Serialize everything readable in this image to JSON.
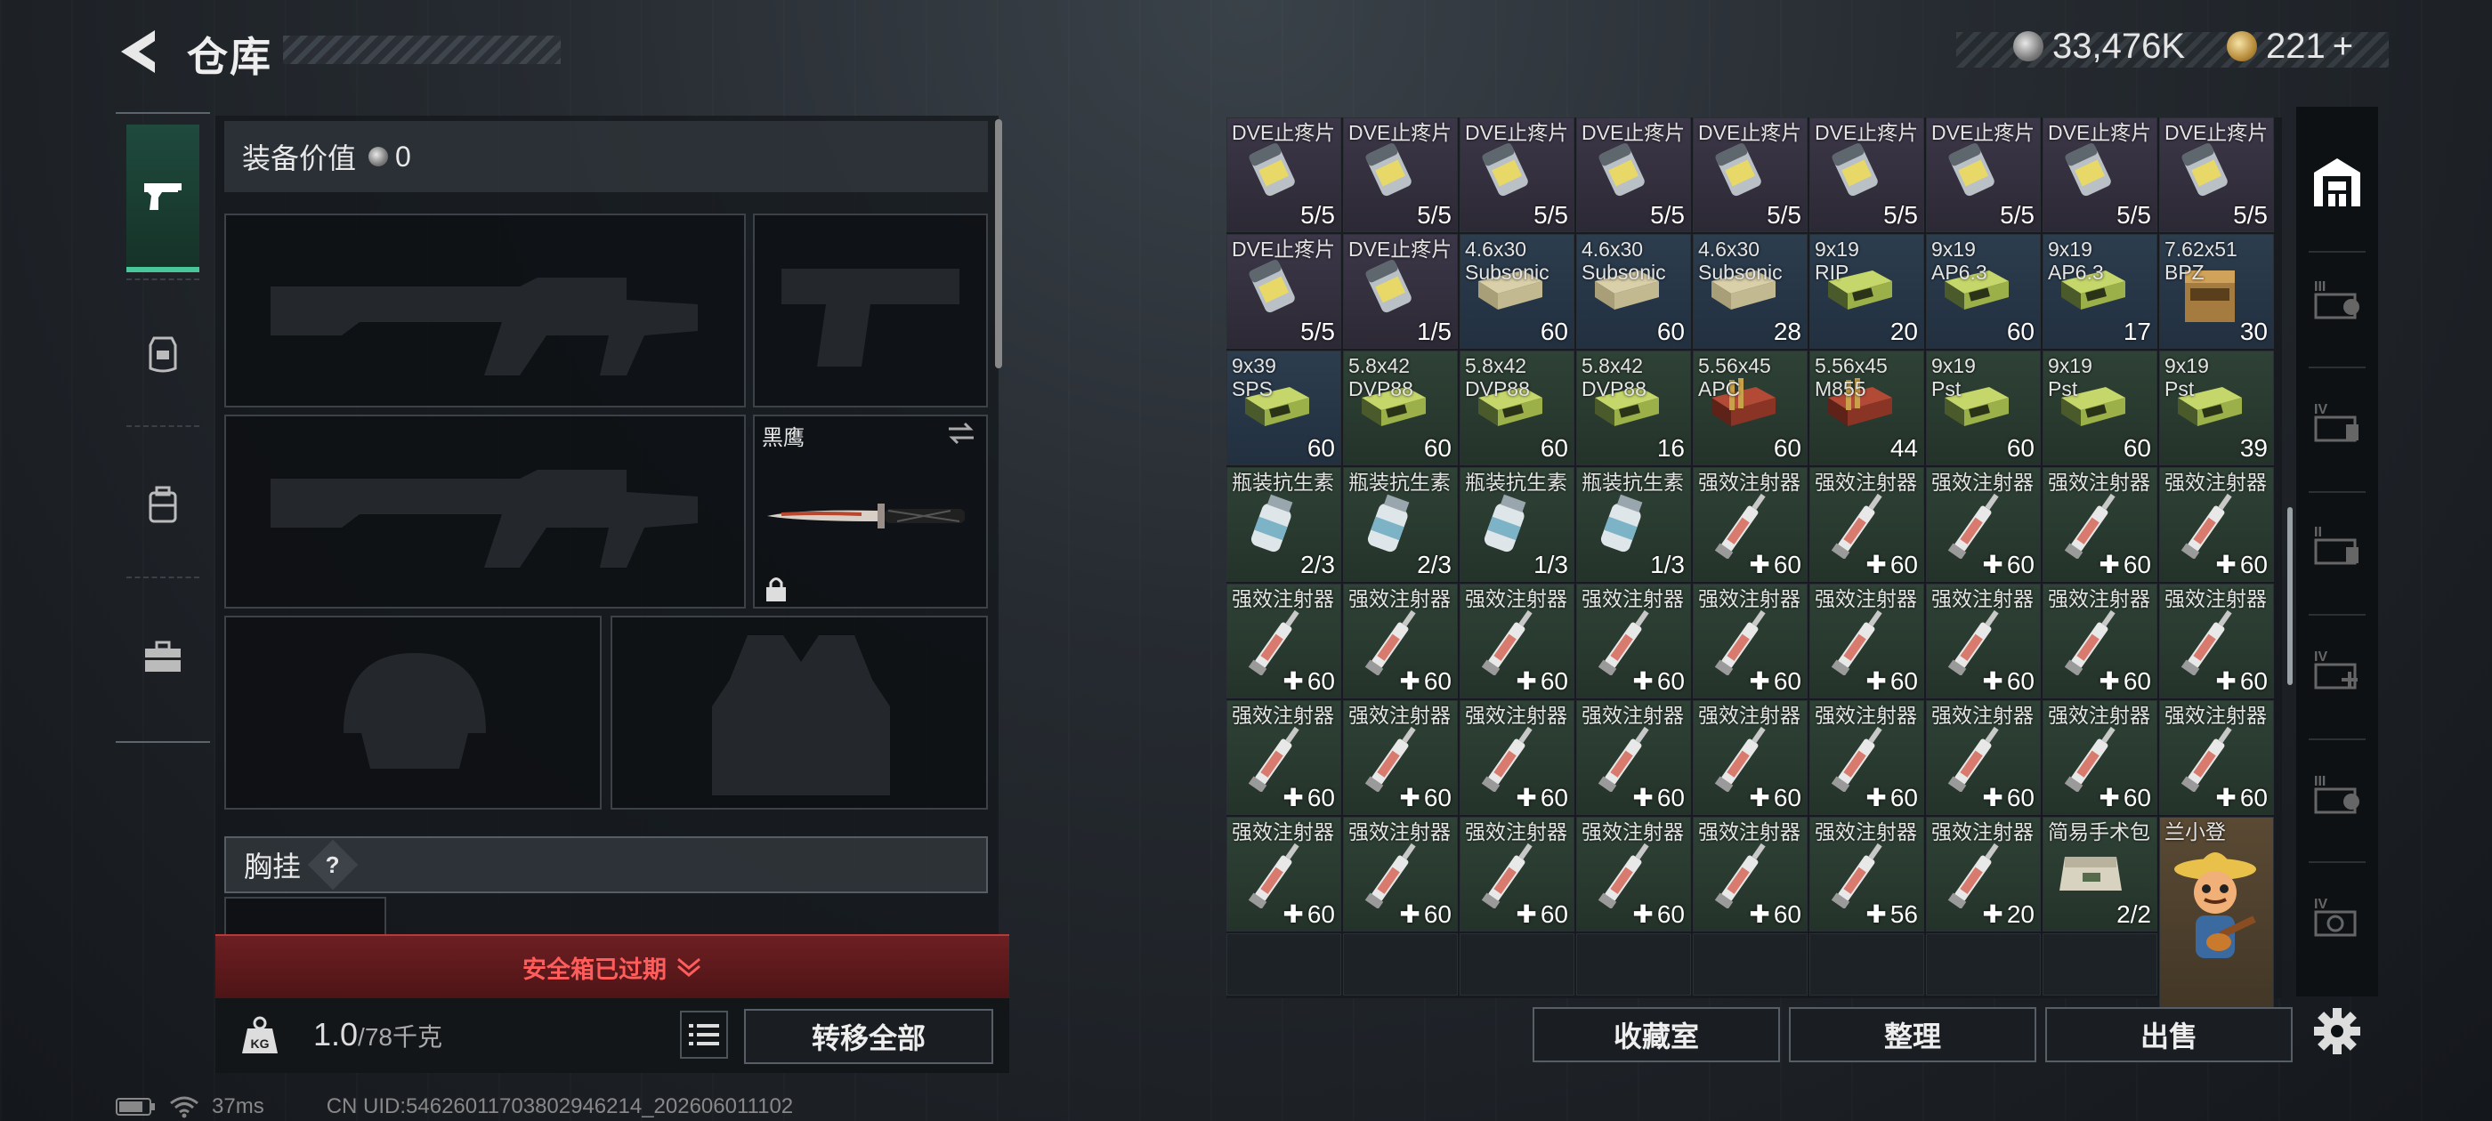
{
  "header": {
    "title": "仓库",
    "silver_amount": "33,476K",
    "gold_amount": "221",
    "gold_add": "+"
  },
  "equipment": {
    "value_label": "装备价值",
    "value": "0",
    "knife_name": "黑鹰",
    "chest_label": "胸挂",
    "chest_help": "?",
    "safebox_text": "安全箱已过期",
    "weight_current": "1.0",
    "weight_max": "/78千克",
    "transfer_all": "转移全部"
  },
  "stash_buttons": {
    "collection": "收藏室",
    "sort": "整理",
    "sell": "出售"
  },
  "status": {
    "ping": "37ms",
    "uid": "CN UID:5462601170380294621‌4_202606011102"
  },
  "stash": {
    "rows": [
      [
        {
          "n": "DVE止疼片",
          "c": "5/5",
          "t": "purple",
          "i": "painkiller"
        },
        {
          "n": "DVE止疼片",
          "c": "5/5",
          "t": "purple",
          "i": "painkiller"
        },
        {
          "n": "DVE止疼片",
          "c": "5/5",
          "t": "purple",
          "i": "painkiller"
        },
        {
          "n": "DVE止疼片",
          "c": "5/5",
          "t": "purple",
          "i": "painkiller"
        },
        {
          "n": "DVE止疼片",
          "c": "5/5",
          "t": "purple",
          "i": "painkiller"
        },
        {
          "n": "DVE止疼片",
          "c": "5/5",
          "t": "purple",
          "i": "painkiller"
        },
        {
          "n": "DVE止疼片",
          "c": "5/5",
          "t": "purple",
          "i": "painkiller"
        },
        {
          "n": "DVE止疼片",
          "c": "5/5",
          "t": "purple",
          "i": "painkiller"
        },
        {
          "n": "DVE止疼片",
          "c": "5/5",
          "t": "purple",
          "i": "painkiller"
        }
      ],
      [
        {
          "n": "DVE止疼片",
          "c": "5/5",
          "t": "purple",
          "i": "painkiller"
        },
        {
          "n": "DVE止疼片",
          "c": "1/5",
          "t": "purple",
          "i": "painkiller"
        },
        {
          "n": "4.6x30",
          "n2": "Subsonic",
          "c": "60",
          "t": "blue",
          "i": "ammo-tan"
        },
        {
          "n": "4.6x30",
          "n2": "Subsonic",
          "c": "60",
          "t": "blue",
          "i": "ammo-tan"
        },
        {
          "n": "4.6x30",
          "n2": "Subsonic",
          "c": "28",
          "t": "blue",
          "i": "ammo-tan"
        },
        {
          "n": "9x19",
          "n2": "RIP",
          "c": "20",
          "t": "blue",
          "i": "ammo-green"
        },
        {
          "n": "9x19",
          "n2": "AP6.3",
          "c": "60",
          "t": "blue",
          "i": "ammo-green"
        },
        {
          "n": "9x19",
          "n2": "AP6.3",
          "c": "17",
          "t": "blue",
          "i": "ammo-green"
        },
        {
          "n": "7.62x51",
          "n2": "BPZ",
          "c": "30",
          "t": "blue",
          "i": "ammo-box"
        }
      ],
      [
        {
          "n": "9x39",
          "n2": "SPS",
          "c": "60",
          "t": "blue",
          "i": "ammo-green"
        },
        {
          "n": "5.8x42",
          "n2": "DVP88",
          "c": "60",
          "t": "green",
          "i": "ammo-green"
        },
        {
          "n": "5.8x42",
          "n2": "DVP88",
          "c": "60",
          "t": "green",
          "i": "ammo-green"
        },
        {
          "n": "5.8x42",
          "n2": "DVP88",
          "c": "16",
          "t": "green",
          "i": "ammo-green"
        },
        {
          "n": "5.56x45",
          "n2": "APC",
          "c": "60",
          "t": "green",
          "i": "ammo-red"
        },
        {
          "n": "5.56x45",
          "n2": "M855",
          "c": "44",
          "t": "green",
          "i": "ammo-red"
        },
        {
          "n": "9x19",
          "n2": "Pst",
          "c": "60",
          "t": "green",
          "i": "ammo-green"
        },
        {
          "n": "9x19",
          "n2": "Pst",
          "c": "60",
          "t": "green",
          "i": "ammo-green"
        },
        {
          "n": "9x19",
          "n2": "Pst",
          "c": "39",
          "t": "green",
          "i": "ammo-green"
        }
      ],
      [
        {
          "n": "瓶装抗生素",
          "c": "2/3",
          "t": "green",
          "i": "bottle"
        },
        {
          "n": "瓶装抗生素",
          "c": "2/3",
          "t": "green",
          "i": "bottle"
        },
        {
          "n": "瓶装抗生素",
          "c": "1/3",
          "t": "green",
          "i": "bottle"
        },
        {
          "n": "瓶装抗生素",
          "c": "1/3",
          "t": "green",
          "i": "bottle"
        },
        {
          "n": "强效注射器",
          "c": "60",
          "h": true,
          "t": "green",
          "i": "syringe"
        },
        {
          "n": "强效注射器",
          "c": "60",
          "h": true,
          "t": "green",
          "i": "syringe"
        },
        {
          "n": "强效注射器",
          "c": "60",
          "h": true,
          "t": "green",
          "i": "syringe"
        },
        {
          "n": "强效注射器",
          "c": "60",
          "h": true,
          "t": "green",
          "i": "syringe"
        },
        {
          "n": "强效注射器",
          "c": "60",
          "h": true,
          "t": "green",
          "i": "syringe"
        }
      ],
      [
        {
          "n": "强效注射器",
          "c": "60",
          "h": true,
          "t": "green",
          "i": "syringe"
        },
        {
          "n": "强效注射器",
          "c": "60",
          "h": true,
          "t": "green",
          "i": "syringe"
        },
        {
          "n": "强效注射器",
          "c": "60",
          "h": true,
          "t": "green",
          "i": "syringe"
        },
        {
          "n": "强效注射器",
          "c": "60",
          "h": true,
          "t": "green",
          "i": "syringe"
        },
        {
          "n": "强效注射器",
          "c": "60",
          "h": true,
          "t": "green",
          "i": "syringe"
        },
        {
          "n": "强效注射器",
          "c": "60",
          "h": true,
          "t": "green",
          "i": "syringe"
        },
        {
          "n": "强效注射器",
          "c": "60",
          "h": true,
          "t": "green",
          "i": "syringe"
        },
        {
          "n": "强效注射器",
          "c": "60",
          "h": true,
          "t": "green",
          "i": "syringe"
        },
        {
          "n": "强效注射器",
          "c": "60",
          "h": true,
          "t": "green",
          "i": "syringe"
        }
      ],
      [
        {
          "n": "强效注射器",
          "c": "60",
          "h": true,
          "t": "green",
          "i": "syringe"
        },
        {
          "n": "强效注射器",
          "c": "60",
          "h": true,
          "t": "green",
          "i": "syringe"
        },
        {
          "n": "强效注射器",
          "c": "60",
          "h": true,
          "t": "green",
          "i": "syringe"
        },
        {
          "n": "强效注射器",
          "c": "60",
          "h": true,
          "t": "green",
          "i": "syringe"
        },
        {
          "n": "强效注射器",
          "c": "60",
          "h": true,
          "t": "green",
          "i": "syringe"
        },
        {
          "n": "强效注射器",
          "c": "60",
          "h": true,
          "t": "green",
          "i": "syringe"
        },
        {
          "n": "强效注射器",
          "c": "60",
          "h": true,
          "t": "green",
          "i": "syringe"
        },
        {
          "n": "强效注射器",
          "c": "60",
          "h": true,
          "t": "green",
          "i": "syringe"
        },
        {
          "n": "强效注射器",
          "c": "60",
          "h": true,
          "t": "green",
          "i": "syringe"
        }
      ],
      [
        {
          "n": "强效注射器",
          "c": "60",
          "h": true,
          "t": "green",
          "i": "syringe"
        },
        {
          "n": "强效注射器",
          "c": "60",
          "h": true,
          "t": "green",
          "i": "syringe"
        },
        {
          "n": "强效注射器",
          "c": "60",
          "h": true,
          "t": "green",
          "i": "syringe"
        },
        {
          "n": "强效注射器",
          "c": "60",
          "h": true,
          "t": "green",
          "i": "syringe"
        },
        {
          "n": "强效注射器",
          "c": "60",
          "h": true,
          "t": "green",
          "i": "syringe"
        },
        {
          "n": "强效注射器",
          "c": "56",
          "h": true,
          "t": "green",
          "i": "syringe"
        },
        {
          "n": "强效注射器",
          "c": "20",
          "h": true,
          "t": "green",
          "i": "syringe"
        },
        {
          "n": "简易手术包",
          "c": "2/2",
          "t": "green",
          "i": "surgical"
        },
        {
          "n": "兰小登",
          "c": "",
          "t": "gold",
          "i": "figure"
        }
      ]
    ]
  },
  "colors": {
    "accent_green": "#49c79a",
    "danger_red": "#ff5c5c",
    "rarity_purple": "#3c3748",
    "rarity_blue": "#2c3d4e",
    "rarity_green": "#2f4236",
    "rarity_gold": "#5a4a34"
  }
}
